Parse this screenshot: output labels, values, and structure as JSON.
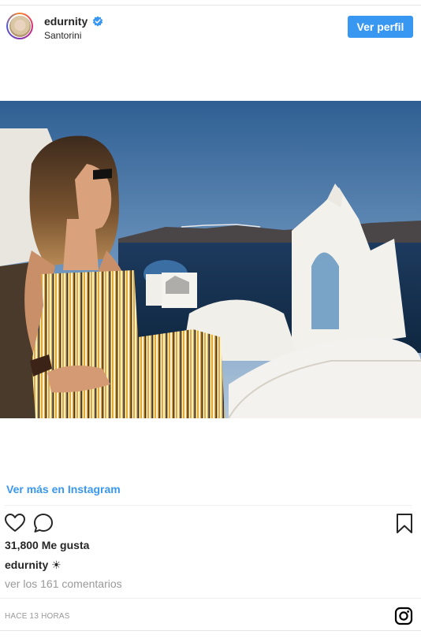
{
  "post": {
    "username": "edurnity",
    "location": "Santorini",
    "profile_button": "Ver perfil",
    "see_more": "Ver más en Instagram",
    "likes": "31,800 Me gusta",
    "caption_user": "edurnity",
    "caption_text": "☀",
    "comments_link": "ver los 161 comentarios",
    "timestamp": "HACE 13 HORAS"
  },
  "icons": {
    "verified": "verified-badge-icon",
    "like": "heart-icon",
    "comment": "comment-bubble-icon",
    "save": "bookmark-icon",
    "instagram": "instagram-logo-icon"
  },
  "colors": {
    "accent": "#3897f0",
    "text": "#262626",
    "muted": "#999999"
  }
}
